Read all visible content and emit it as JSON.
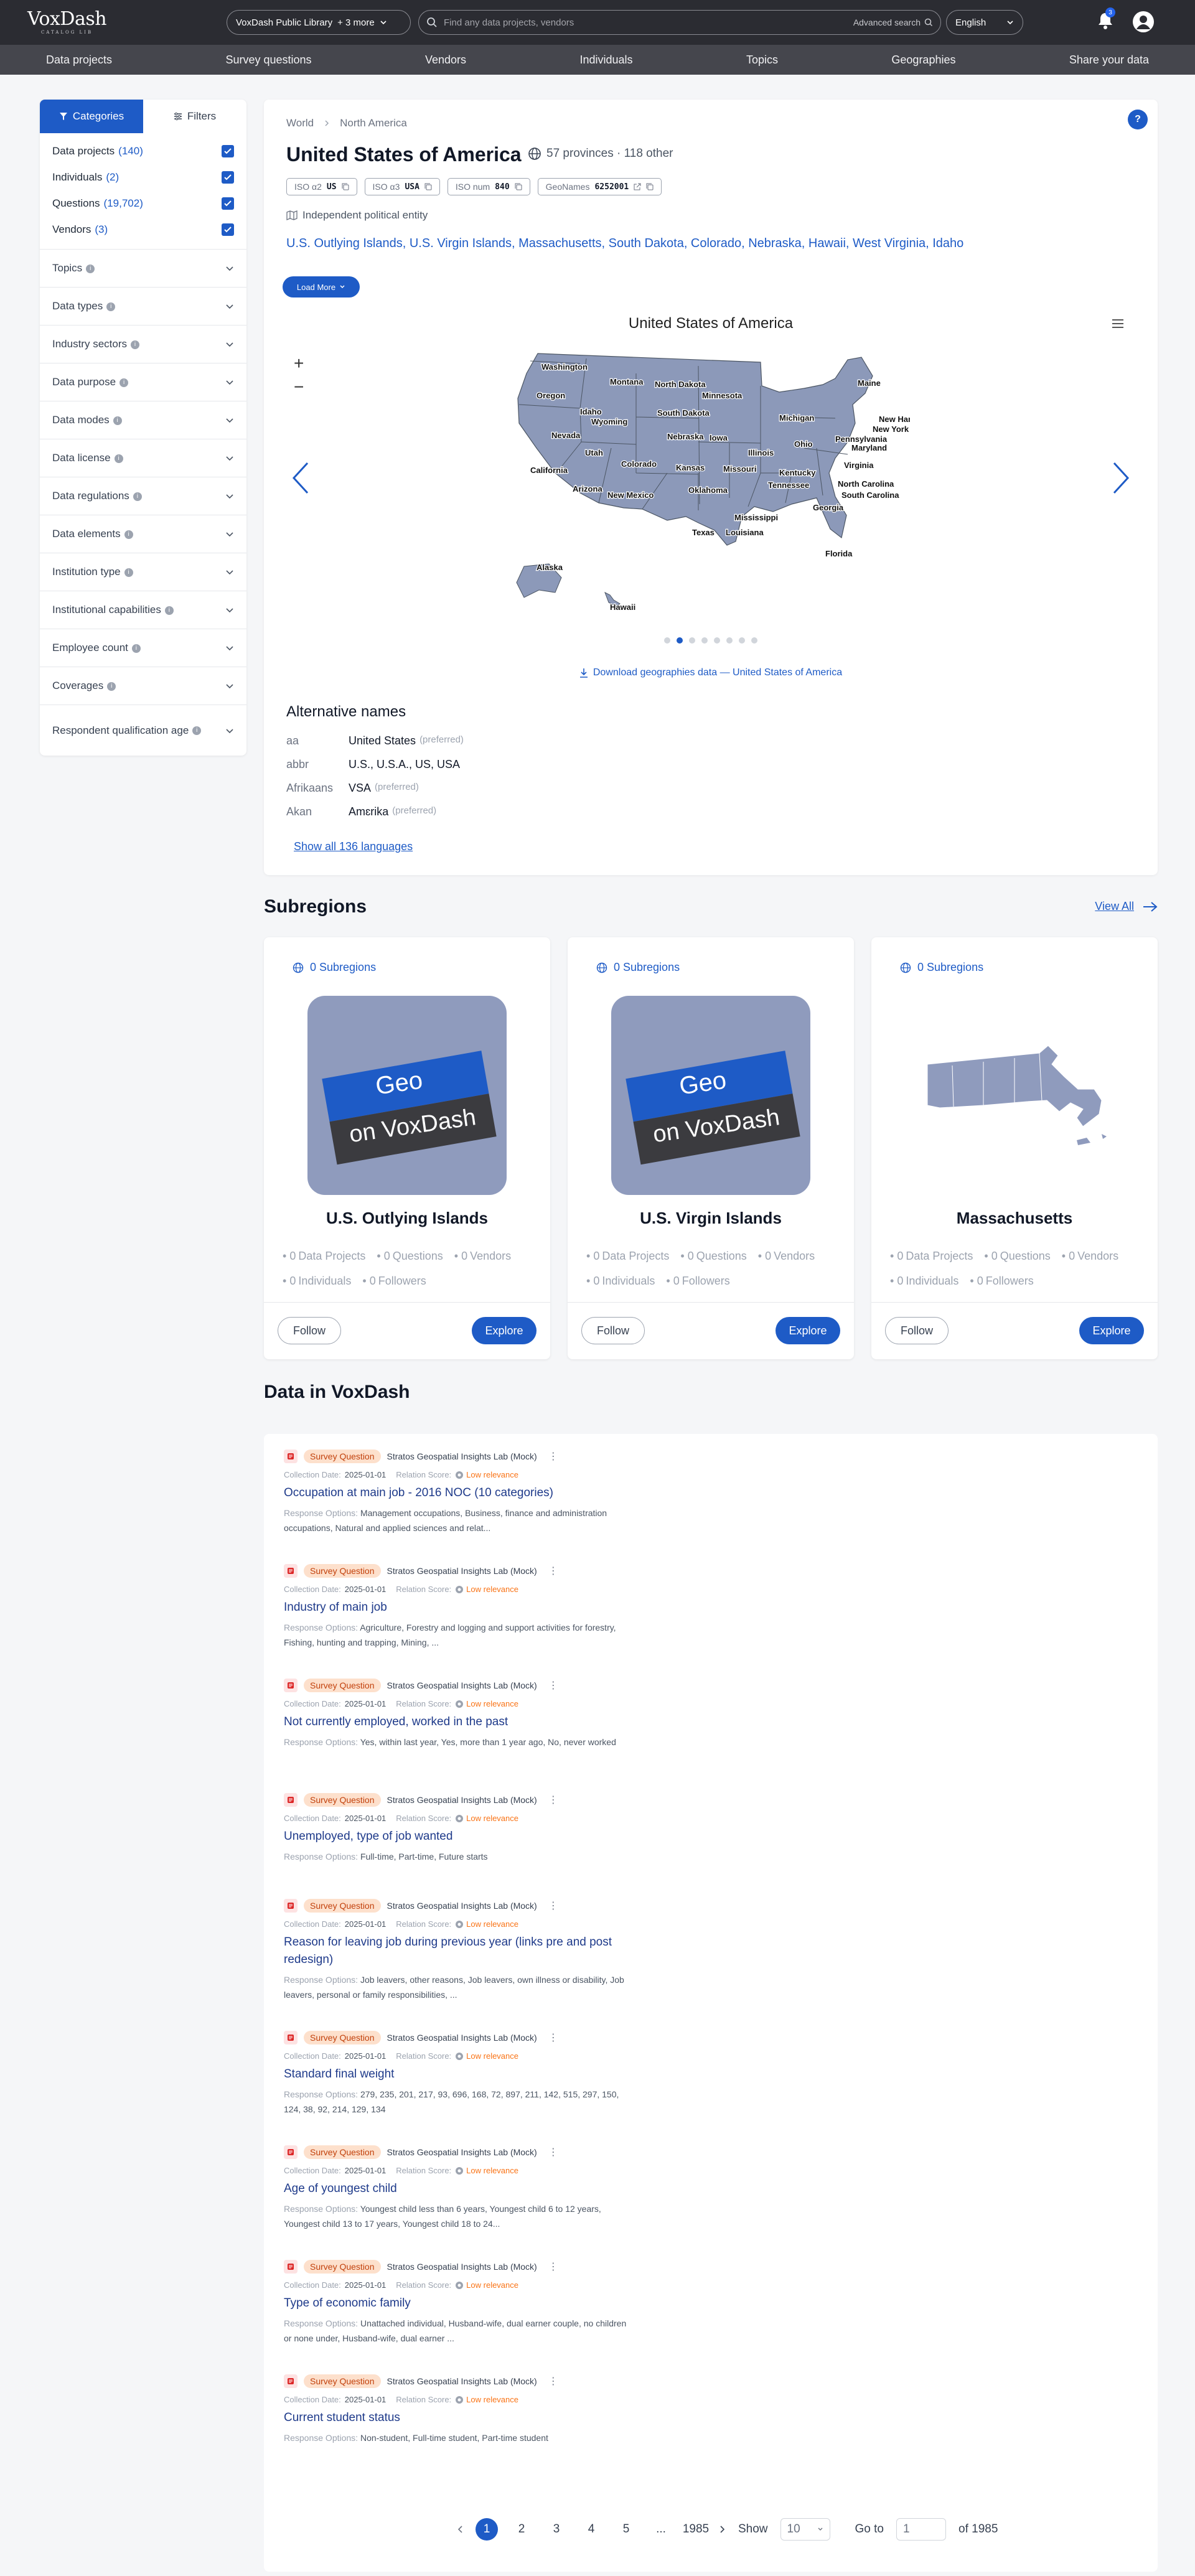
{
  "brand": {
    "name": "VoxDash",
    "tagline": "CATALOG LIB"
  },
  "header": {
    "library_label": "VoxDash Public Library",
    "library_more": "+ 3 more",
    "search_placeholder": "Find any data projects, vendors",
    "advanced_search": "Advanced search",
    "language": "English",
    "notification_count": "3"
  },
  "nav": [
    "Data projects",
    "Survey questions",
    "Vendors",
    "Individuals",
    "Topics",
    "Geographies",
    "Share your data"
  ],
  "sidebar": {
    "tab_categories": "Categories",
    "tab_filters": "Filters",
    "categories": [
      {
        "label": "Data projects",
        "count": "(140)"
      },
      {
        "label": "Individuals",
        "count": "(2)"
      },
      {
        "label": "Questions",
        "count": "(19,702)"
      },
      {
        "label": "Vendors",
        "count": "(3)"
      }
    ],
    "facets": [
      "Topics",
      "Data types",
      "Industry sectors",
      "Data purpose",
      "Data modes",
      "Data license",
      "Data regulations",
      "Data elements",
      "Institution type",
      "Institutional capabilities",
      "Employee count",
      "Coverages",
      "Respondent qualification age"
    ]
  },
  "geo": {
    "breadcrumb": [
      "World",
      "North America"
    ],
    "title": "United States of America",
    "meta": "57 provinces · 118 other",
    "codes": [
      {
        "label": "ISO α2",
        "value": "US"
      },
      {
        "label": "ISO α3",
        "value": "USA"
      },
      {
        "label": "ISO num",
        "value": "840"
      },
      {
        "label": "GeoNames",
        "value": "6252001"
      }
    ],
    "entity_type": "Independent political entity",
    "subregion_links": "U.S. Outlying Islands, U.S. Virgin Islands, Massachusetts, South Dakota, Colorado, Nebraska, Hawaii, West Virginia, Idaho",
    "load_more": "Load More",
    "map_title": "United States of America",
    "download": "Download geographies data — United States of America",
    "states": [
      {
        "name": "Washington"
      },
      {
        "name": "Montana"
      },
      {
        "name": "North Dakota"
      },
      {
        "name": "Minnesota"
      },
      {
        "name": "Maine"
      },
      {
        "name": "Oregon"
      },
      {
        "name": "Idaho"
      },
      {
        "name": "South Dakota"
      },
      {
        "name": "Wyoming"
      },
      {
        "name": "Michigan"
      },
      {
        "name": "New Hampshire"
      },
      {
        "name": "New York"
      },
      {
        "name": "Nevada"
      },
      {
        "name": "Iowa"
      },
      {
        "name": "Nebraska"
      },
      {
        "name": "Pennsylvania"
      },
      {
        "name": "Ohio"
      },
      {
        "name": "Maryland"
      },
      {
        "name": "Utah"
      },
      {
        "name": "Illinois"
      },
      {
        "name": "California"
      },
      {
        "name": "Colorado"
      },
      {
        "name": "Kansas"
      },
      {
        "name": "Missouri"
      },
      {
        "name": "Virginia"
      },
      {
        "name": "Kentucky"
      },
      {
        "name": "North Carolina"
      },
      {
        "name": "Tennessee"
      },
      {
        "name": "Arizona"
      },
      {
        "name": "New Mexico"
      },
      {
        "name": "Oklahoma"
      },
      {
        "name": "South Carolina"
      },
      {
        "name": "Georgia"
      },
      {
        "name": "Mississippi"
      },
      {
        "name": "Texas"
      },
      {
        "name": "Louisiana"
      },
      {
        "name": "Florida"
      },
      {
        "name": "Alaska"
      },
      {
        "name": "Hawaii"
      }
    ],
    "alt_heading": "Alternative names",
    "alt_names": [
      {
        "lang": "aa",
        "value": "United States",
        "pref": "(preferred)"
      },
      {
        "lang": "abbr",
        "value": "U.S.,  U.S.A.,  US,  USA",
        "pref": ""
      },
      {
        "lang": "Afrikaans",
        "value": "VSA",
        "pref": "(preferred)"
      },
      {
        "lang": "Akan",
        "value": "Amɛrika",
        "pref": "(preferred)"
      }
    ],
    "show_all": "Show all 136 languages"
  },
  "subregions": {
    "heading": "Subregions",
    "view_all": "View All",
    "cards": [
      {
        "count": "0 Subregions",
        "name": "U.S. Outlying Islands",
        "img": "Geo",
        "img2": "on VoxDash",
        "projects": "0",
        "questions": "0",
        "vendors": "0",
        "individuals": "0",
        "followers": "0"
      },
      {
        "count": "0 Subregions",
        "name": "U.S. Virgin Islands",
        "img": "Geo",
        "img2": "on VoxDash",
        "projects": "0",
        "questions": "0",
        "vendors": "0",
        "individuals": "0",
        "followers": "0"
      },
      {
        "count": "0 Subregions",
        "name": "Massachusetts",
        "img": "",
        "img2": "",
        "projects": "0",
        "questions": "0",
        "vendors": "0",
        "individuals": "0",
        "followers": "0"
      }
    ],
    "labels": {
      "projects": "Data Projects",
      "questions": "Questions",
      "vendors": "Vendors",
      "individuals": "Individuals",
      "followers": "Followers",
      "follow": "Follow",
      "explore": "Explore"
    }
  },
  "data": {
    "heading": "Data in VoxDash",
    "labels": {
      "date": "Collection Date:",
      "relation": "Relation Score:",
      "low": "Low relevance",
      "options": "Response Options:"
    },
    "items": [
      {
        "tag": "Survey Question",
        "source": "Stratos Geospatial Insights Lab (Mock)",
        "date": "2025-01-01",
        "title": "Occupation at main job - 2016 NOC (10 categories)",
        "options": "Management occupations, Business, finance and administration occupations, Natural and applied sciences and relat..."
      },
      {
        "tag": "Survey Question",
        "source": "Stratos Geospatial Insights Lab (Mock)",
        "date": "2025-01-01",
        "title": "Industry of main job",
        "options": "Agriculture, Forestry and logging and support activities for forestry, Fishing, hunting and trapping, Mining, ..."
      },
      {
        "tag": "Survey Question",
        "source": "Stratos Geospatial Insights Lab (Mock)",
        "date": "2025-01-01",
        "title": "Not currently employed, worked in the past",
        "options": "Yes, within last year, Yes, more than 1 year ago, No, never worked"
      },
      {
        "tag": "Survey Question",
        "source": "Stratos Geospatial Insights Lab (Mock)",
        "date": "2025-01-01",
        "title": "Unemployed, type of job wanted",
        "options": "Full-time, Part-time, Future starts"
      },
      {
        "tag": "Survey Question",
        "source": "Stratos Geospatial Insights Lab (Mock)",
        "date": "2025-01-01",
        "title": "Reason for leaving job during previous year (links pre and post redesign)",
        "options": "Job leavers, other reasons, Job leavers, own illness or disability, Job leavers, personal or family responsibilities, ..."
      },
      {
        "tag": "Survey Question",
        "source": "Stratos Geospatial Insights Lab (Mock)",
        "date": "2025-01-01",
        "title": "Standard final weight",
        "options": "279, 235, 201, 217, 93, 696, 168, 72, 897, 211, 142, 515, 297, 150, 124, 38, 92, 214, 129, 134"
      },
      {
        "tag": "Survey Question",
        "source": "Stratos Geospatial Insights Lab (Mock)",
        "date": "2025-01-01",
        "title": "Age of youngest child",
        "options": "Youngest child less than 6 years, Youngest child 6 to 12 years, Youngest child 13 to 17 years, Youngest child 18 to 24..."
      },
      {
        "tag": "Survey Question",
        "source": "Stratos Geospatial Insights Lab (Mock)",
        "date": "2025-01-01",
        "title": "Type of economic family",
        "options": "Unattached individual, Husband-wife, dual earner couple, no children or none under, Husband-wife, dual earner ..."
      },
      {
        "tag": "Survey Question",
        "source": "Stratos Geospatial Insights Lab (Mock)",
        "date": "2025-01-01",
        "title": "Current student status",
        "options": "Non-student, Full-time student, Part-time student"
      }
    ],
    "pager": {
      "pages": [
        "1",
        "2",
        "3",
        "4",
        "5",
        "...",
        "1985"
      ],
      "show_label": "Show",
      "show_value": "10",
      "goto_label": "Go to",
      "goto_value": "1",
      "of": "of 1985"
    }
  }
}
